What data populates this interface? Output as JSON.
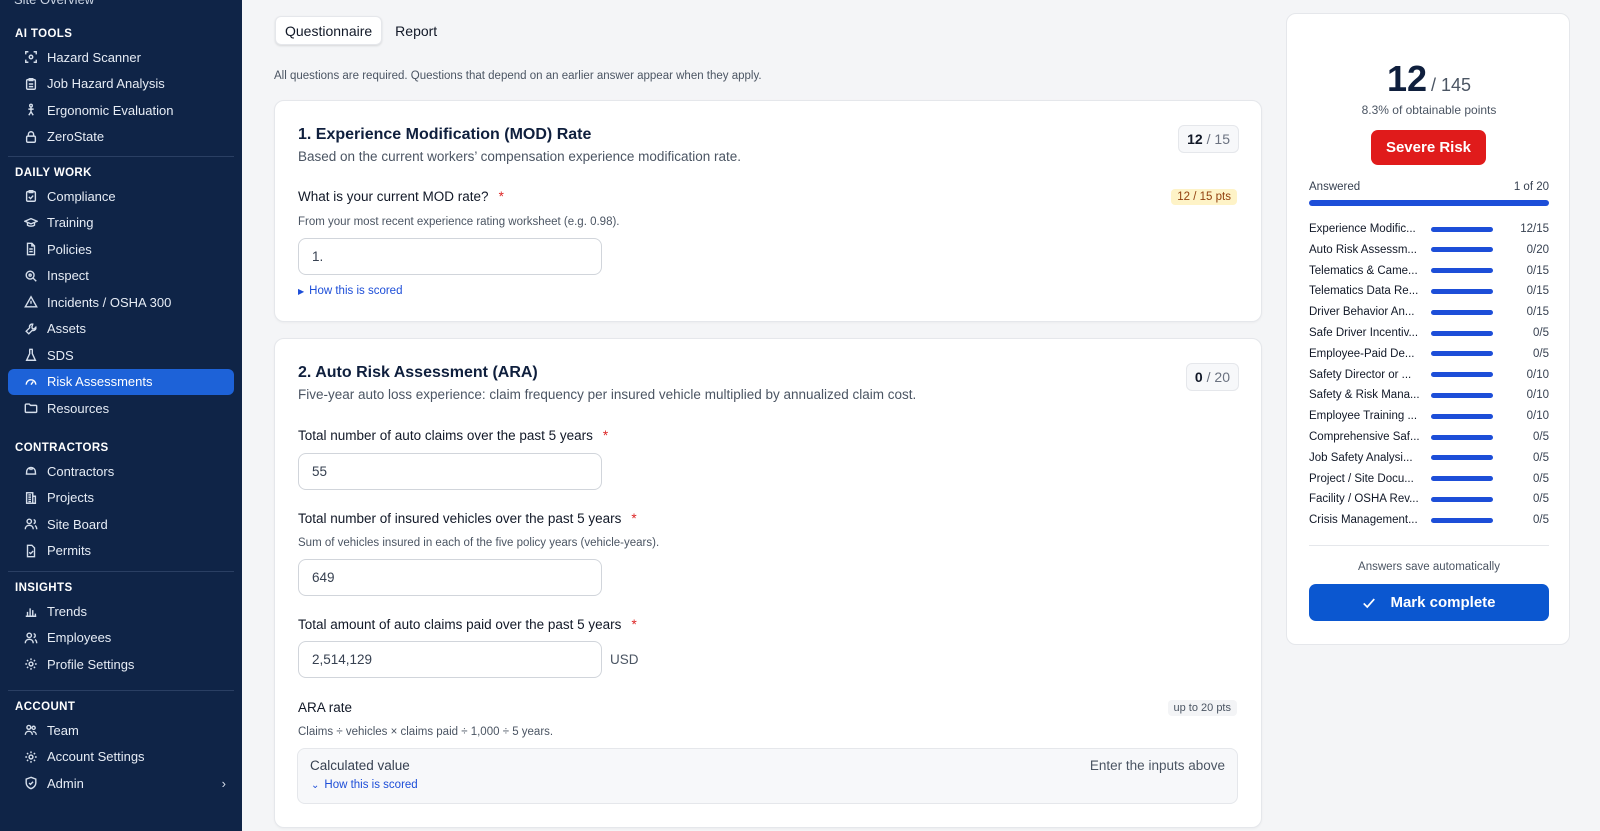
{
  "sidebar": {
    "cut_item": "Site Overview",
    "sections": [
      {
        "title": "AI TOOLS",
        "items": [
          {
            "label": "Hazard Scanner",
            "icon": "scan-icon"
          },
          {
            "label": "Job Hazard Analysis",
            "icon": "clipboard-icon"
          },
          {
            "label": "Ergonomic Evaluation",
            "icon": "person-icon"
          },
          {
            "label": "ZeroState",
            "icon": "lock-icon"
          }
        ]
      },
      {
        "title": "DAILY WORK",
        "items": [
          {
            "label": "Compliance",
            "icon": "clipboard-check-icon"
          },
          {
            "label": "Training",
            "icon": "graduation-cap-icon"
          },
          {
            "label": "Policies",
            "icon": "document-icon"
          },
          {
            "label": "Inspect",
            "icon": "search-icon"
          },
          {
            "label": "Incidents / OSHA 300",
            "icon": "warning-icon"
          },
          {
            "label": "Assets",
            "icon": "wrench-icon"
          },
          {
            "label": "SDS",
            "icon": "flask-icon"
          },
          {
            "label": "Risk Assessments",
            "icon": "gauge-icon"
          },
          {
            "label": "Resources",
            "icon": "folder-icon"
          }
        ]
      },
      {
        "title": "CONTRACTORS",
        "items": [
          {
            "label": "Contractors",
            "icon": "hard-hat-icon"
          },
          {
            "label": "Projects",
            "icon": "building-icon"
          },
          {
            "label": "Site Board",
            "icon": "users-icon"
          },
          {
            "label": "Permits",
            "icon": "file-check-icon"
          }
        ]
      },
      {
        "title": "INSIGHTS",
        "items": [
          {
            "label": "Trends",
            "icon": "bar-chart-icon"
          },
          {
            "label": "Employees",
            "icon": "users-icon"
          },
          {
            "label": "Profile Settings",
            "icon": "gear-icon"
          }
        ]
      },
      {
        "title": "ACCOUNT",
        "items": [
          {
            "label": "Team",
            "icon": "team-icon"
          },
          {
            "label": "Account Settings",
            "icon": "gear-icon"
          },
          {
            "label": "Admin",
            "icon": "shield-icon"
          }
        ]
      }
    ],
    "active": "Risk Assessments"
  },
  "tabs": [
    {
      "label": "Questionnaire"
    },
    {
      "label": "Report"
    }
  ],
  "note": "All questions are required. Questions that depend on an earlier answer appear when they apply.",
  "q1": {
    "title": "1. Experience Modification (MOD) Rate",
    "desc": "Based on the current workers’ compensation experience modification rate.",
    "score": "12",
    "max": "/ 15",
    "question": "What is your current MOD rate?",
    "required": "*",
    "pts": "12 / 15 pts",
    "hint": "From your most recent experience rating worksheet (e.g. 0.98).",
    "value": "1.",
    "link": "How this is scored"
  },
  "q2": {
    "title": "2. Auto Risk Assessment (ARA)",
    "desc": "Five-year auto loss experience: claim frequency per insured vehicle multiplied by annualized claim cost.",
    "score": "0",
    "max": "/ 20",
    "claims_label": "Total number of auto claims over the past 5 years",
    "claims_value": "55",
    "vehicles_label": "Total number of insured vehicles over the past 5 years",
    "vehicles_hint": "Sum of vehicles insured in each of the five policy years (vehicle-years).",
    "vehicles_value": "649",
    "paid_label": "Total amount of auto claims paid over the past 5 years",
    "paid_value": "2,514,129",
    "paid_unit": "USD",
    "required": "*",
    "ara_label": "ARA rate",
    "ara_badge": "up to 20 pts",
    "ara_hint": "Claims ÷ vehicles × claims paid ÷ 1,000 ÷ 5 years.",
    "calc_label": "Calculated value",
    "calc_right": "Enter the inputs above",
    "link": "How this is scored"
  },
  "panel": {
    "score": "12",
    "max": "/ 145",
    "pct": "8.3% of obtainable points",
    "risk": "Severe Risk",
    "answered_label": "Answered",
    "answered_value": "1 of 20",
    "answered_fraction": 1.0,
    "categories": [
      {
        "name": "Experience Modific...",
        "val": "12/15"
      },
      {
        "name": "Auto Risk Assessm...",
        "val": "0/20"
      },
      {
        "name": "Telematics & Came...",
        "val": "0/15"
      },
      {
        "name": "Telematics Data Re...",
        "val": "0/15"
      },
      {
        "name": "Driver Behavior An...",
        "val": "0/15"
      },
      {
        "name": "Safe Driver Incentiv...",
        "val": "0/5"
      },
      {
        "name": "Employee-Paid De...",
        "val": "0/5"
      },
      {
        "name": "Safety Director or ...",
        "val": "0/10"
      },
      {
        "name": "Safety & Risk Mana...",
        "val": "0/10"
      },
      {
        "name": "Employee Training ...",
        "val": "0/10"
      },
      {
        "name": "Comprehensive Saf...",
        "val": "0/5"
      },
      {
        "name": "Job Safety Analysi...",
        "val": "0/5"
      },
      {
        "name": "Project / Site Docu...",
        "val": "0/5"
      },
      {
        "name": "Facility / OSHA Rev...",
        "val": "0/5"
      },
      {
        "name": "Crisis Management...",
        "val": "0/5"
      }
    ],
    "autosave": "Answers save automatically",
    "mark_complete": "Mark complete"
  }
}
